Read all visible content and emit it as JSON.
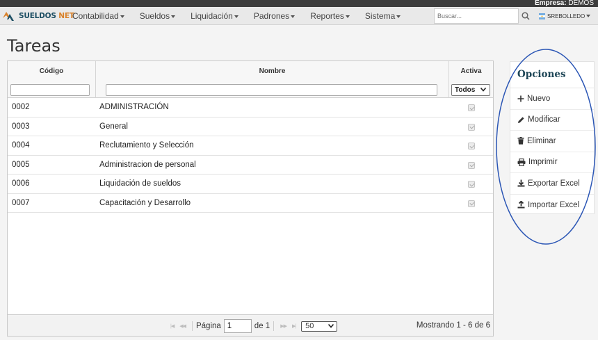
{
  "company": {
    "label": "Empresa:",
    "name": "DEMOS"
  },
  "brand": {
    "prefix": "SUELDOS",
    "suffix": "NET"
  },
  "nav": [
    "Contabilidad",
    "Sueldos",
    "Liquidación",
    "Padrones",
    "Reportes",
    "Sistema"
  ],
  "search": {
    "placeholder": "Buscar..."
  },
  "user": {
    "name": "SREBOLLEDO"
  },
  "page": {
    "title": "Tareas"
  },
  "grid": {
    "columns": {
      "code": "Código",
      "name": "Nombre",
      "active": "Activa"
    },
    "active_filter": "Todos",
    "rows": [
      {
        "code": "0002",
        "name": "ADMINISTRACIÓN",
        "active": true
      },
      {
        "code": "0003",
        "name": "General",
        "active": true
      },
      {
        "code": "0004",
        "name": "Reclutamiento y Selección",
        "active": true
      },
      {
        "code": "0005",
        "name": "Administracion de personal",
        "active": true
      },
      {
        "code": "0006",
        "name": "Liquidación de sueldos",
        "active": true
      },
      {
        "code": "0007",
        "name": "Capacitación y Desarrollo",
        "active": true
      }
    ]
  },
  "pager": {
    "page_label": "Página",
    "page_value": "1",
    "of_label": "de 1",
    "page_size": "50",
    "record_info": "Mostrando 1 - 6 de 6"
  },
  "options": {
    "title": "Opciones",
    "items": [
      {
        "label": "Nuevo",
        "icon": "plus-icon"
      },
      {
        "label": "Modificar",
        "icon": "pencil-icon"
      },
      {
        "label": "Eliminar",
        "icon": "trash-icon"
      },
      {
        "label": "Imprimir",
        "icon": "print-icon"
      },
      {
        "label": "Exportar Excel",
        "icon": "download-icon"
      },
      {
        "label": "Importar Excel",
        "icon": "upload-icon"
      }
    ]
  },
  "colors": {
    "brand": "#1d4e63",
    "brand_accent": "#d9822b",
    "oval": "#2b56b5"
  }
}
